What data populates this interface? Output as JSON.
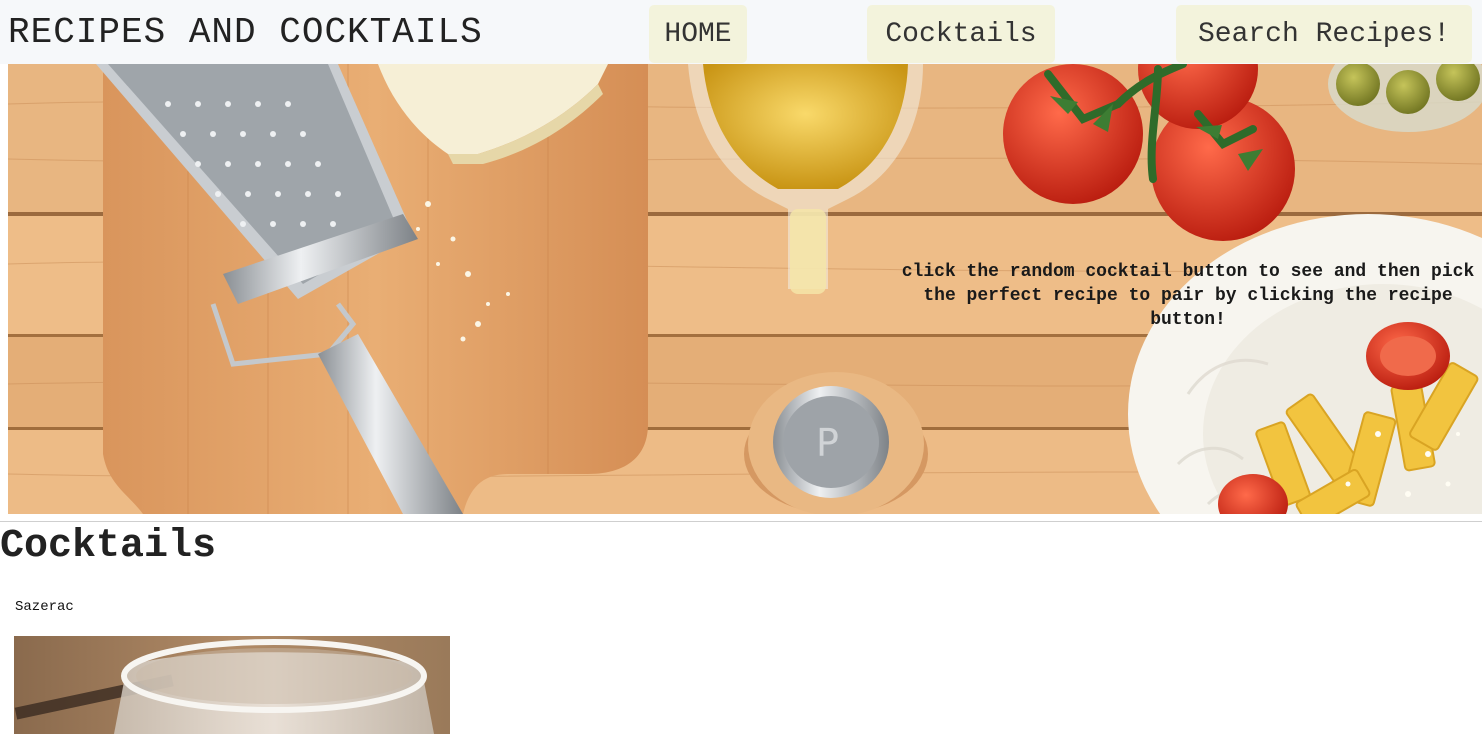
{
  "header": {
    "site_title": "RECIPES AND COCKTAILS",
    "nav": {
      "home": "HOME",
      "cocktails": "Cocktails",
      "search": "Search Recipes!"
    }
  },
  "hero": {
    "instruction": "click the random cocktail button to see and then pick the perfect recipe to pair by clicking the recipe button!",
    "image_subject": "wooden table with cutting board, cheese grater, parmesan, olive oil, tomatoes, salt shaker, olives and pasta plate"
  },
  "main": {
    "section_title": "Cocktails",
    "cards": [
      {
        "name": "Sazerac",
        "image_subject": "glass of cocktail on wooden surface"
      }
    ]
  },
  "colors": {
    "topbar_bg": "#f6f8fa",
    "nav_button_bg": "#f3f3dc",
    "wood": "#e2ad78"
  }
}
